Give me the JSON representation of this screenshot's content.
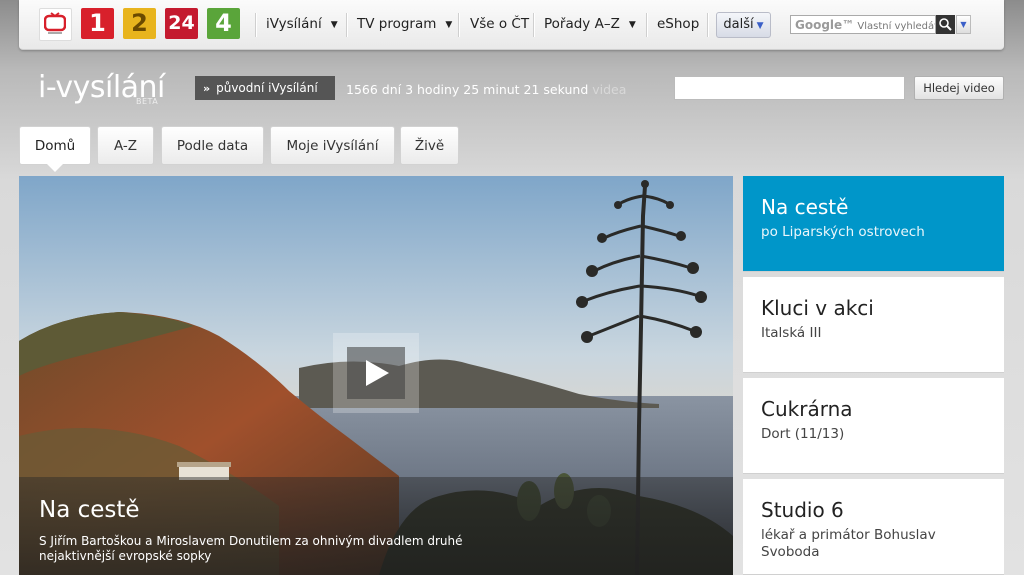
{
  "topbar": {
    "channels": [
      "1",
      "2",
      "24",
      "4"
    ],
    "nav": [
      {
        "label": "iVysílání",
        "dropdown": true
      },
      {
        "label": "TV program",
        "dropdown": true
      },
      {
        "label": "Vše o ČT",
        "dropdown": false
      },
      {
        "label": "Pořady A–Z",
        "dropdown": true
      },
      {
        "label": "eShop",
        "dropdown": false
      }
    ],
    "more_label": "další",
    "google_brand": "Google™",
    "google_placeholder": "Vlastní vyhledávání"
  },
  "header": {
    "logo": "i-vysílání",
    "logo_sub": "BETA",
    "original_button": "původní iVysílání",
    "counter_text": "1566 dní 3 hodiny 25 minut 21 sekund",
    "counter_suffix": "videa",
    "search_value": "",
    "search_button": "Hledej video"
  },
  "tabs": [
    "Domů",
    "A-Z",
    "Podle data",
    "Moje iVysílání",
    "Živě"
  ],
  "active_tab": "Domů",
  "hero": {
    "title": "Na cestě",
    "description": "S Jiřím Bartoškou a Miroslavem Donutilem za ohnivým divadlem druhé nejaktivnější evropské sopky"
  },
  "side_items": [
    {
      "title": "Na cestě",
      "subtitle": "po Liparských ostrovech"
    },
    {
      "title": "Kluci v akci",
      "subtitle": "Italská III"
    },
    {
      "title": "Cukrárna",
      "subtitle": "Dort (11/13)"
    },
    {
      "title": "Studio 6",
      "subtitle": "lékař a primátor Bohuslav Svoboda"
    }
  ],
  "colors": {
    "accent": "#0096c9",
    "channel1": "#d8202b",
    "channel2": "#e8b41d",
    "channel24": "#c41a2f",
    "channel4": "#5aa53a"
  }
}
